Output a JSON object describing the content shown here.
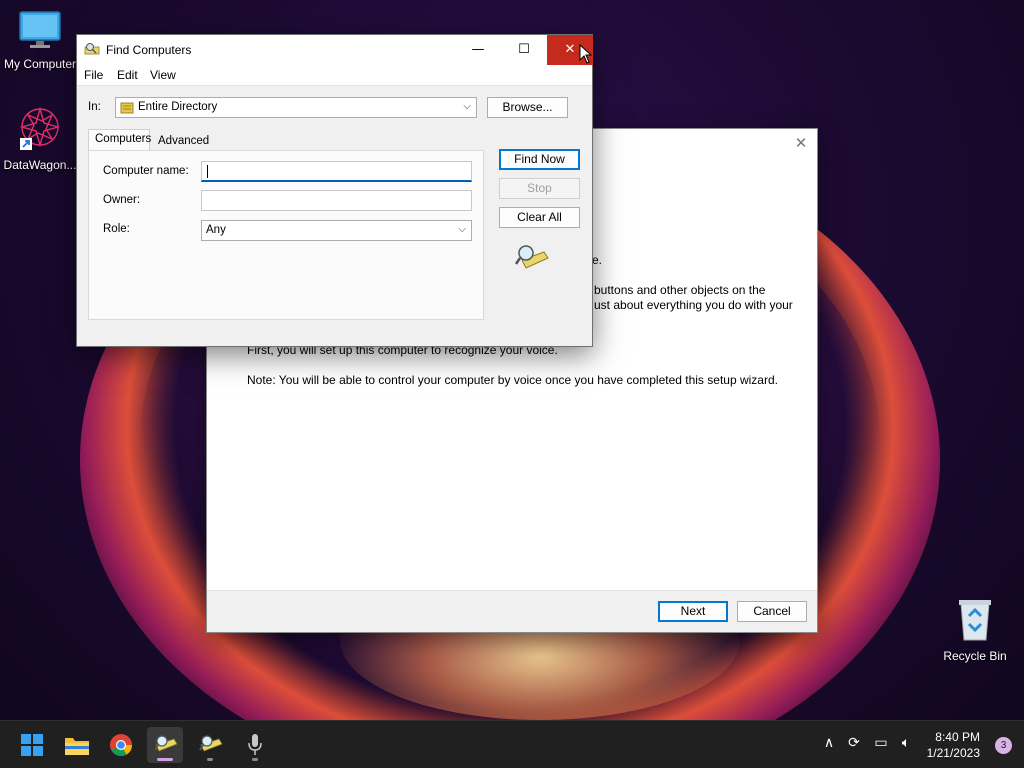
{
  "desktop": {
    "icons": [
      {
        "label": "My Computer"
      },
      {
        "label": "DataWagon..."
      },
      {
        "label": "Recycle Bin"
      }
    ]
  },
  "wizard": {
    "partial_line1": "e.",
    "partial_line2a": "buttons and other objects on the",
    "partial_line2b": "ust about everything you do with your",
    "line3": "First, you will set up this computer to recognize your voice.",
    "line4": "Note: You will be able to control your computer by voice once you have completed this setup wizard.",
    "next_label": "Next",
    "cancel_label": "Cancel"
  },
  "find_dialog": {
    "title": "Find Computers",
    "menu": [
      "File",
      "Edit",
      "View"
    ],
    "in_label": "In:",
    "in_value": "Entire Directory",
    "browse_label": "Browse...",
    "tabs": [
      "Computers",
      "Advanced"
    ],
    "computer_name_label": "Computer name:",
    "computer_name_value": "",
    "owner_label": "Owner:",
    "owner_value": "",
    "role_label": "Role:",
    "role_value": "Any",
    "find_now_label": "Find Now",
    "stop_label": "Stop",
    "clear_all_label": "Clear All"
  },
  "taskbar": {
    "apps": [
      "start-icon",
      "file-explorer-icon",
      "chrome-icon",
      "find-computers-icon",
      "find-computers-icon",
      "microphone-icon"
    ],
    "time": "8:40 PM",
    "date": "1/21/2023",
    "notification_count": "3"
  }
}
